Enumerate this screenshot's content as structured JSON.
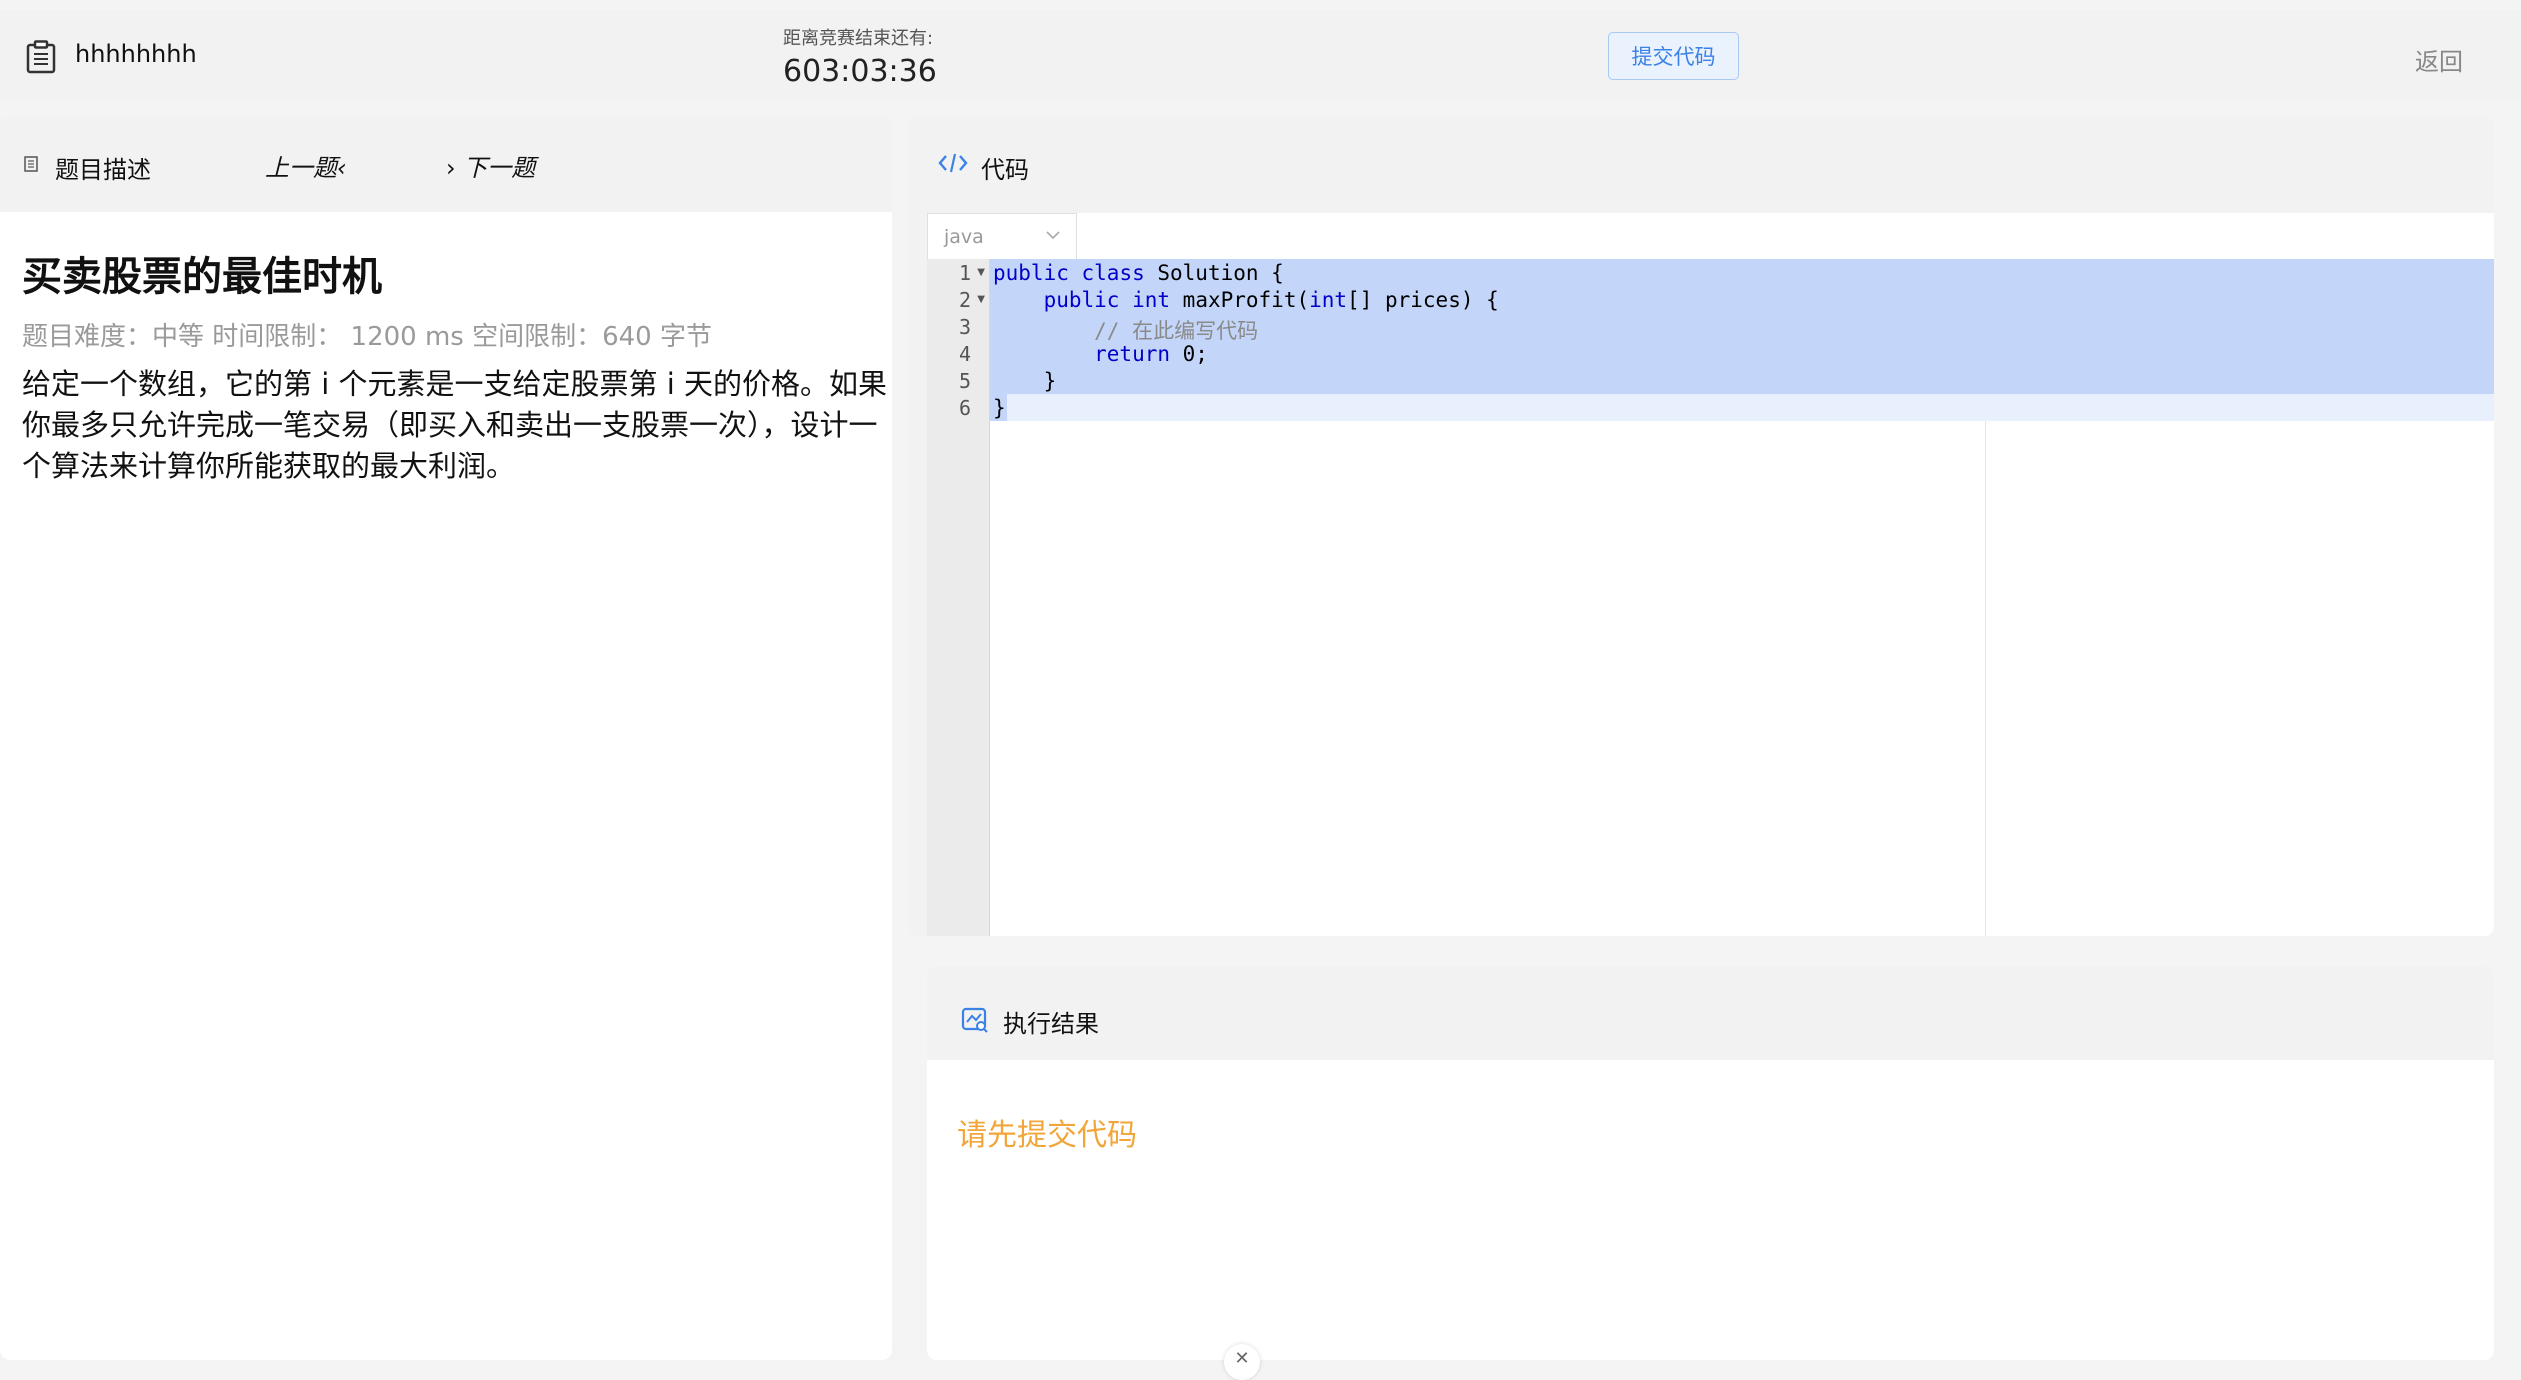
{
  "header": {
    "username": "hhhhhhhh",
    "countdown_label": "距离竞赛结束还有:",
    "countdown_time": "603:03:36",
    "submit_label": "提交代码",
    "back_label": "返回"
  },
  "problem": {
    "tab_label": "题目描述",
    "prev_label": "上一题",
    "next_label": "下一题",
    "title": "买卖股票的最佳时机",
    "meta": "题目难度：中等 时间限制： 1200 ms 空间限制：640 字节",
    "description": "给定一个数组，它的第 i 个元素是一支给定股票第 i 天的价格。如果你最多只允许完成一笔交易（即买入和卖出一支股票一次），设计一个算法来计算你所能获取的最大利润。"
  },
  "code": {
    "panel_label": "代码",
    "language": "java",
    "lines": [
      {
        "num": "1",
        "fold": true
      },
      {
        "num": "2",
        "fold": true
      },
      {
        "num": "3",
        "fold": false
      },
      {
        "num": "4",
        "fold": false
      },
      {
        "num": "5",
        "fold": false
      },
      {
        "num": "6",
        "fold": false
      }
    ],
    "line1": {
      "kw1": "public",
      "kw2": "class",
      "rest": " Solution {"
    },
    "line2": {
      "indent": "    ",
      "kw1": "public",
      "kw2": "int",
      "mid": " maxProfit(",
      "kw3": "int",
      "rest": "[] prices) {"
    },
    "line3": {
      "comment": "        // 在此编写代码"
    },
    "line4": {
      "kw": "        return",
      "rest": " 0;"
    },
    "line5": {
      "text": "    }"
    },
    "line6": {
      "text": "}"
    }
  },
  "result": {
    "panel_label": "执行结果",
    "message": "请先提交代码"
  },
  "colors": {
    "accent": "#3b82e6",
    "warning": "#f2a63a",
    "selection": "#c3d6f9"
  }
}
